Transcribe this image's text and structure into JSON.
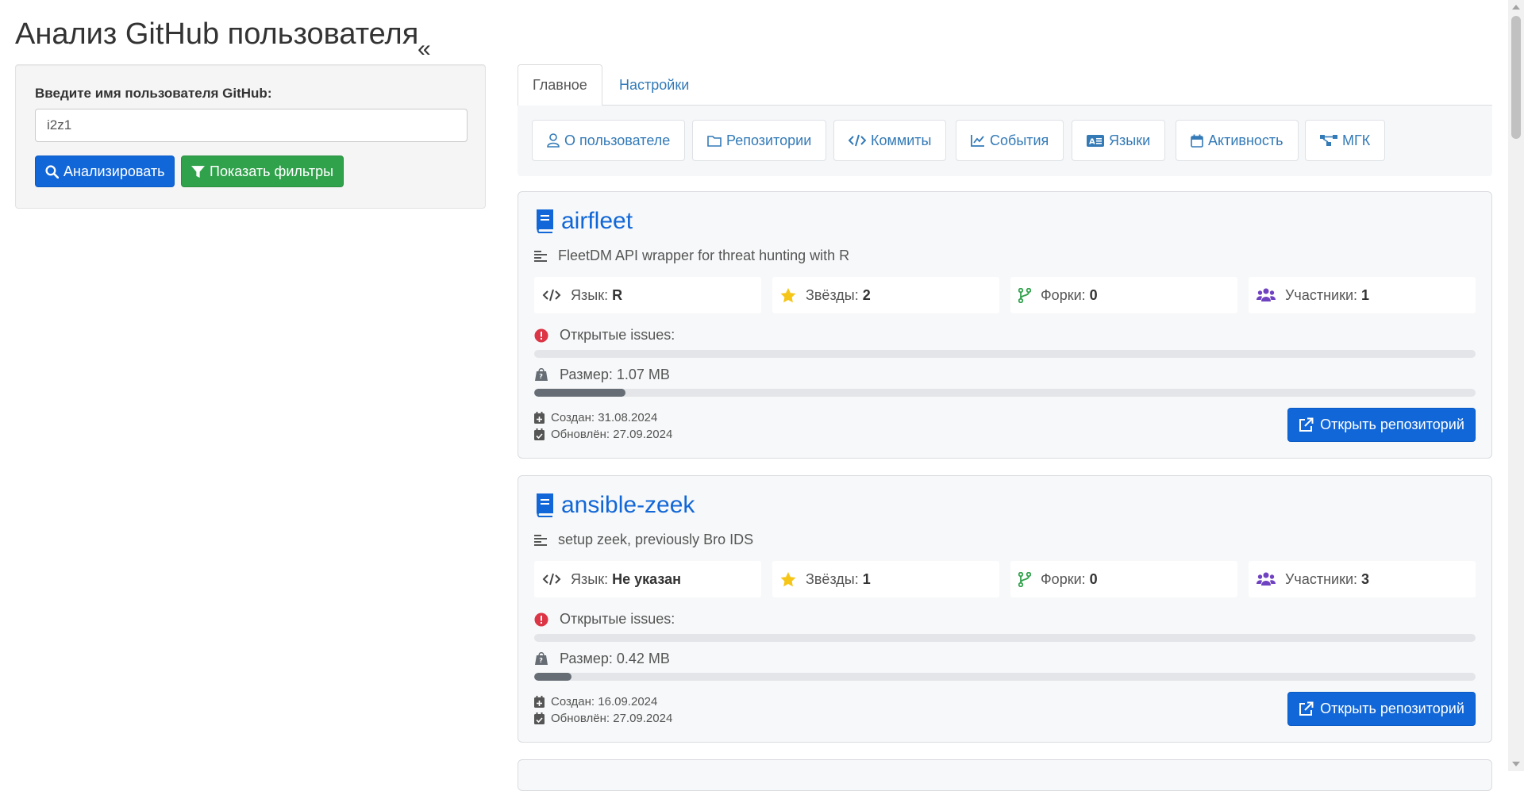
{
  "header": {
    "title": "Анализ GitHub пользователя",
    "collapse_icon": "«"
  },
  "sidebar": {
    "username_label": "Введите имя пользователя GitHub:",
    "username_value": "i2z1",
    "analyze_button": "Анализировать",
    "filters_button": "Показать фильтры"
  },
  "tabs": [
    {
      "label": "Главное",
      "active": true
    },
    {
      "label": "Настройки",
      "active": false
    }
  ],
  "subnav": [
    {
      "label": "О пользователе",
      "icon": "user-icon"
    },
    {
      "label": "Репозитории",
      "icon": "folder-icon"
    },
    {
      "label": "Коммиты",
      "icon": "code-icon"
    },
    {
      "label": "События",
      "icon": "line-chart-icon"
    },
    {
      "label": "Языки",
      "icon": "language-icon"
    },
    {
      "label": "Активность",
      "icon": "calendar-icon"
    },
    {
      "label": "МГК",
      "icon": "network-icon"
    }
  ],
  "repos": [
    {
      "name": "airfleet",
      "description": "FleetDM API wrapper for threat hunting with R",
      "language_label": "Язык:",
      "language": "R",
      "stars_label": "Звёзды:",
      "stars": "2",
      "forks_label": "Форки:",
      "forks": "0",
      "contributors_label": "Участники:",
      "contributors": "1",
      "issues_label": "Открытые issues:",
      "issues_fraction": 0,
      "size_label": "Размер: 1.07 MB",
      "size_fraction": 0.097,
      "created": "Создан: 31.08.2024",
      "updated": "Обновлён: 27.09.2024",
      "open_button": "Открыть репозиторий"
    },
    {
      "name": "ansible-zeek",
      "description": "setup zeek, previously Bro IDS",
      "language_label": "Язык:",
      "language": "Не указан",
      "stars_label": "Звёзды:",
      "stars": "1",
      "forks_label": "Форки:",
      "forks": "0",
      "contributors_label": "Участники:",
      "contributors": "3",
      "issues_label": "Открытые issues:",
      "issues_fraction": 0,
      "size_label": "Размер: 0.42 MB",
      "size_fraction": 0.04,
      "created": "Создан: 16.09.2024",
      "updated": "Обновлён: 27.09.2024",
      "open_button": "Открыть репозиторий"
    }
  ],
  "colors": {
    "primary": "#1167d8",
    "success": "#31a24c",
    "star": "#f5c518",
    "fork": "#31a24c",
    "people": "#6f42c1",
    "issue": "#dc3545"
  }
}
